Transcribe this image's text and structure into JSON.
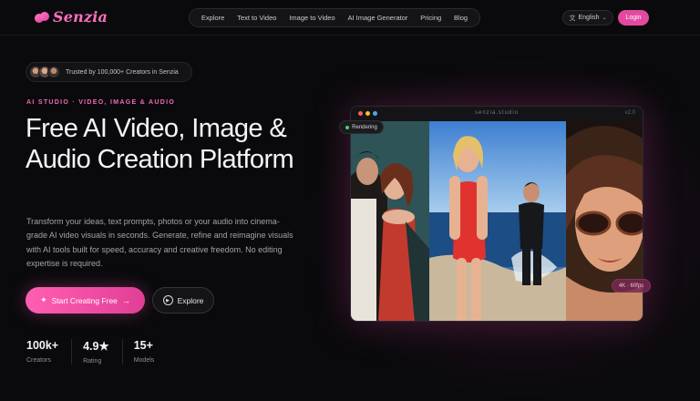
{
  "brand": {
    "name": "Senzia",
    "accent": "#e24aa0"
  },
  "nav": {
    "links": [
      "Explore",
      "Text to Video",
      "Image to Video",
      "AI Image Generator",
      "Pricing",
      "Blog"
    ],
    "language": "English",
    "language_icon": "translate-icon",
    "login": "Login"
  },
  "hero": {
    "trust_text": "Trusted by 100,000+ Creators in Senzia",
    "eyebrow": "AI STUDIO · VIDEO, IMAGE & AUDIO",
    "headline": "Free AI Video, Image & Audio Creation Platform",
    "description": "Transform your ideas, text prompts, photos or your audio into cinema-grade AI video visuals in seconds. Generate, refine and reimagine visuals with AI tools built for speed, accuracy and creative freedom. No editing expertise is required.",
    "cta_primary": "Start Creating Free",
    "cta_primary_icons": [
      "sparkle-icon",
      "arrow-right-icon"
    ],
    "cta_secondary": "Explore",
    "cta_secondary_icon": "play-icon"
  },
  "stats": [
    {
      "value": "100k+",
      "label": "Creators"
    },
    {
      "value": "4.9★",
      "label": "Rating"
    },
    {
      "value": "15+",
      "label": "Models"
    }
  ],
  "preview": {
    "window_title": "senzia.studio",
    "version": "v2.0",
    "status": "Rendering",
    "badge": "4K · 60fps"
  }
}
